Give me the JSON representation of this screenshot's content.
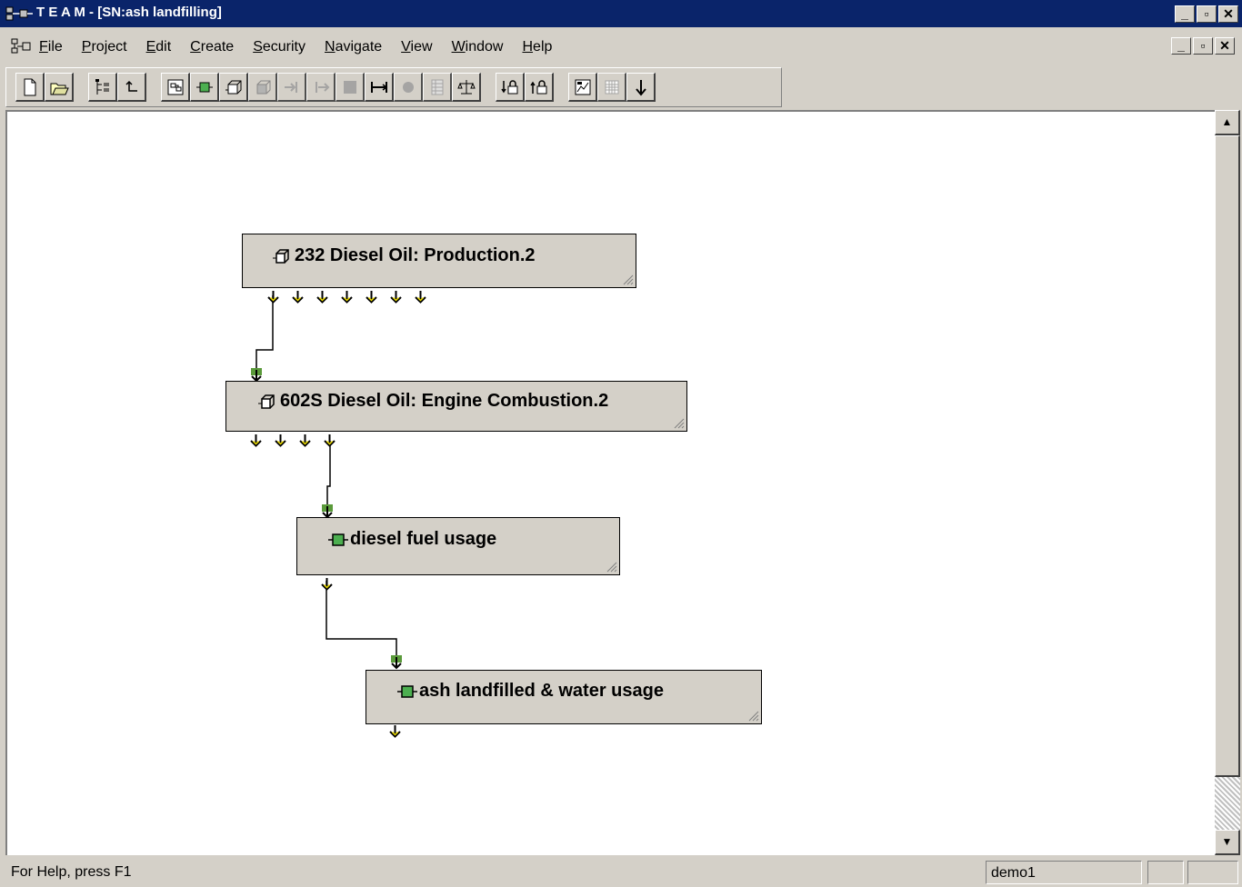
{
  "window": {
    "title": "T E A M - [SN:ash landfilling]"
  },
  "menu": {
    "items": [
      "File",
      "Project",
      "Edit",
      "Create",
      "Security",
      "Navigate",
      "View",
      "Window",
      "Help"
    ]
  },
  "toolbar": {
    "buttons": [
      "new-document-icon",
      "open-folder-icon",
      "tree-view-icon",
      "go-up-icon",
      "module-view-icon",
      "process-icon",
      "stacked-process-icon",
      "stacked-process-disabled-icon",
      "input-flow-icon",
      "output-flow-icon",
      "stop-icon",
      "span-icon",
      "hexagon-icon",
      "table-icon",
      "balance-icon",
      "lock-down-icon",
      "lock-up-icon",
      "report-icon",
      "grid-icon",
      "down-arrow-icon"
    ]
  },
  "diagram": {
    "nodes": [
      {
        "id": "n1",
        "label": "232 Diesel Oil: Production.2",
        "icon": "module-stack-icon"
      },
      {
        "id": "n2",
        "label": "602S Diesel Oil: Engine Combustion.2",
        "icon": "module-stack-icon"
      },
      {
        "id": "n3",
        "label": "diesel fuel usage",
        "icon": "process-block-icon"
      },
      {
        "id": "n4",
        "label": "ash landfilled & water usage",
        "icon": "process-block-icon"
      }
    ],
    "arrow_color": "#f0e000",
    "inlet_color": "#5a9a3a"
  },
  "statusbar": {
    "help_text": "For Help, press F1",
    "user": "demo1"
  }
}
